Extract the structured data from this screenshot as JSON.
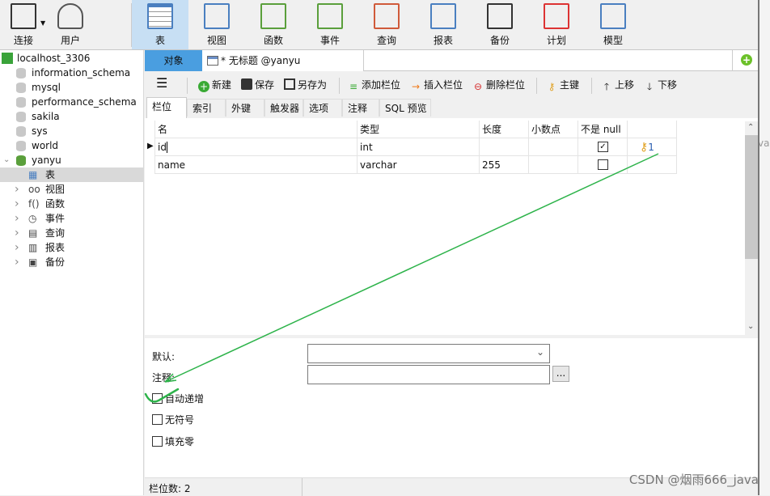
{
  "toolbar": {
    "items": [
      {
        "label": "连接",
        "icon": "plug-server-icon"
      },
      {
        "label": "用户",
        "icon": "user-icon"
      },
      {
        "label": "表",
        "icon": "table-icon",
        "active": true
      },
      {
        "label": "视图",
        "icon": "view-glasses-icon"
      },
      {
        "label": "函数",
        "icon": "function-icon"
      },
      {
        "label": "事件",
        "icon": "event-clock-icon"
      },
      {
        "label": "查询",
        "icon": "query-icon"
      },
      {
        "label": "报表",
        "icon": "report-icon"
      },
      {
        "label": "备份",
        "icon": "backup-tape-icon"
      },
      {
        "label": "计划",
        "icon": "schedule-calendar-icon"
      },
      {
        "label": "模型",
        "icon": "model-icon"
      }
    ]
  },
  "sidebar": {
    "connection": "localhost_3306",
    "databases": [
      "information_schema",
      "mysql",
      "performance_schema",
      "sakila",
      "sys",
      "world",
      "yanyu"
    ],
    "children": [
      "表",
      "视图",
      "函数",
      "事件",
      "查询",
      "报表",
      "备份"
    ]
  },
  "tabs": {
    "objects": "对象",
    "document": "* 无标题 @yanyu (localhost_..."
  },
  "editor_toolbar": {
    "new": "新建",
    "save": "保存",
    "save_as": "另存为",
    "add_field": "添加栏位",
    "insert_field": "插入栏位",
    "delete_field": "删除栏位",
    "primary_key": "主键",
    "move_up": "上移",
    "move_down": "下移"
  },
  "subtabs": [
    "栏位",
    "索引",
    "外键",
    "触发器",
    "选项",
    "注释",
    "SQL 预览"
  ],
  "grid": {
    "headers": [
      "名",
      "类型",
      "长度",
      "小数点",
      "不是 null",
      ""
    ],
    "rows": [
      {
        "name": "id",
        "type": "int",
        "length": "",
        "decimals": "",
        "not_null": true,
        "key": "1"
      },
      {
        "name": "name",
        "type": "varchar",
        "length": "255",
        "decimals": "",
        "not_null": false,
        "key": ""
      }
    ]
  },
  "props": {
    "default_label": "默认:",
    "default_value": "",
    "comment_label": "注释:",
    "comment_value": "",
    "ellipsis": "...",
    "auto_increment": "自动递增",
    "unsigned": "无符号",
    "zerofill": "填充零"
  },
  "status": {
    "field_count": "栏位数: 2"
  },
  "watermark": "CSDN @烟雨666_java",
  "right_strip": {
    "fragment": "va"
  },
  "colors": {
    "active_tab": "#4a9ee0",
    "toolbar_active": "#c7dff4",
    "annotation": "#2db34a"
  }
}
